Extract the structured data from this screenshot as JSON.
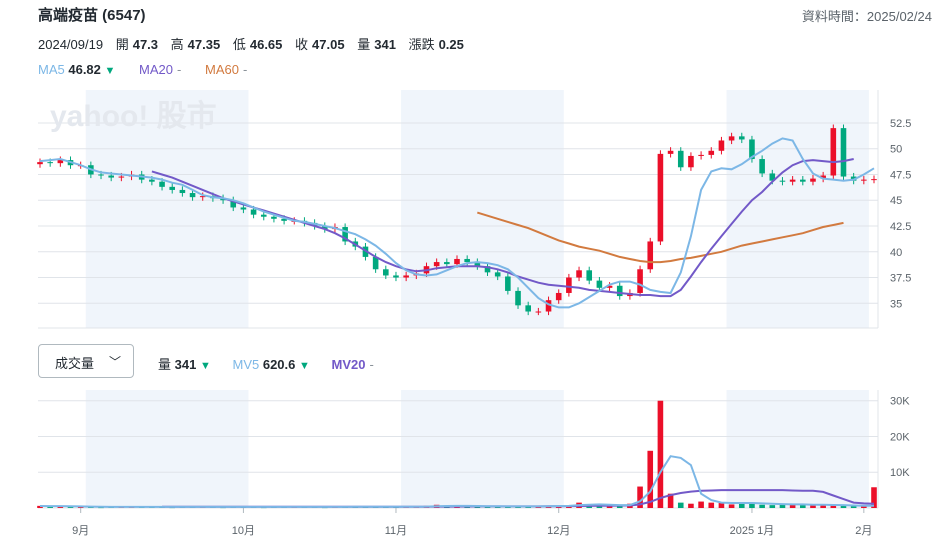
{
  "header": {
    "title": "高端疫苗 (6547)",
    "data_time": "資料時間：2025/02/24"
  },
  "ohlc": {
    "date": "2024/09/19",
    "open_label": "開",
    "open": "47.3",
    "high_label": "高",
    "high": "47.35",
    "low_label": "低",
    "low": "46.65",
    "close_label": "收",
    "close": "47.05",
    "volume_label": "量",
    "volume": "341",
    "change_label": "漲跌",
    "change": "0.25"
  },
  "ma_legend": {
    "ma5_label": "MA5",
    "ma5_value": "46.82",
    "ma20_label": "MA20",
    "ma60_label": "MA60",
    "dash": "-"
  },
  "vol_legend": {
    "dropdown_label": "成交量",
    "vol_label": "量",
    "vol_value": "341",
    "mv5_label": "MV5",
    "mv5_value": "620.6",
    "mv20_label": "MV20",
    "dash": "-"
  },
  "watermark": "yahoo! 股市",
  "colors": {
    "up": "#eb0f29",
    "down": "#00a87e",
    "ma5": "#7cb7e6",
    "ma20": "#7259c8",
    "ma60": "#d27a3f",
    "band": "#f0f5fb",
    "grid": "#e0e4e9"
  },
  "chart_data": [
    {
      "type": "candlestick",
      "title": "高端疫苗 (6547)",
      "y_ticks": [
        "52.5",
        "50",
        "47.5",
        "45",
        "42.5",
        "40",
        "37.5",
        "35"
      ],
      "ylim": [
        32.6,
        55.7
      ],
      "x_ticks": [
        "9月",
        "10月",
        "11月",
        "12月",
        "2025 1月",
        "2月"
      ],
      "series": [
        {
          "name": "MA5",
          "values": [
            48.8,
            48.9,
            49.0,
            48.7,
            48.4,
            48.0,
            47.7,
            47.6,
            47.5,
            47.4,
            47.3,
            47.2,
            47.0,
            46.7,
            46.5,
            46.0,
            45.5,
            45.3,
            45.2,
            45.0,
            44.7,
            44.3,
            43.9,
            43.6,
            43.3,
            43.0,
            42.9,
            42.7,
            42.5,
            42.3,
            42.0,
            41.7,
            41.2,
            40.6,
            39.8,
            38.9,
            38.2,
            37.8,
            37.7,
            37.8,
            38.2,
            38.6,
            38.9,
            39.0,
            38.9,
            38.7,
            38.3,
            37.5,
            36.5,
            35.5,
            34.9,
            34.6,
            34.6,
            35.0,
            35.6,
            36.2,
            36.8,
            37.1,
            37.1,
            36.8,
            36.3,
            36.1,
            36.0,
            38.0,
            41.5,
            46.0,
            47.8,
            48.1,
            48.0,
            48.5,
            49.2,
            49.8,
            50.5,
            51.0,
            50.8,
            49.0,
            47.6,
            47.1,
            47.0,
            46.9,
            47.0,
            47.5,
            48.1
          ]
        },
        {
          "name": "MA20",
          "values": [
            null,
            null,
            null,
            null,
            null,
            null,
            null,
            null,
            null,
            null,
            null,
            47.8,
            47.5,
            47.2,
            46.8,
            46.4,
            46.0,
            45.6,
            45.2,
            44.9,
            44.6,
            44.3,
            44.0,
            43.7,
            43.4,
            43.1,
            42.8,
            42.5,
            42.2,
            41.8,
            41.3,
            40.7,
            40.1,
            39.5,
            39.0,
            38.6,
            38.3,
            38.1,
            38.2,
            38.4,
            38.5,
            38.6,
            38.6,
            38.6,
            38.5,
            38.3,
            38.0,
            37.6,
            37.3,
            37.0,
            36.8,
            36.7,
            36.6,
            36.5,
            36.3,
            36.2,
            36.1,
            36.0,
            35.9,
            35.8,
            35.8,
            35.7,
            35.7,
            36.3,
            37.6,
            39.0,
            40.3,
            41.5,
            42.7,
            43.9,
            45.0,
            45.8,
            46.8,
            47.7,
            48.4,
            48.8,
            48.9,
            48.8,
            48.7,
            48.8,
            49.0,
            null,
            null
          ]
        },
        {
          "name": "MA60",
          "values": [
            null,
            null,
            null,
            null,
            null,
            null,
            null,
            null,
            null,
            null,
            null,
            null,
            null,
            null,
            null,
            null,
            null,
            null,
            null,
            null,
            null,
            null,
            null,
            null,
            null,
            null,
            null,
            null,
            null,
            null,
            null,
            null,
            null,
            null,
            null,
            null,
            null,
            null,
            null,
            null,
            null,
            null,
            null,
            43.8,
            43.5,
            43.2,
            42.9,
            42.6,
            42.3,
            41.9,
            41.5,
            41.1,
            40.8,
            40.5,
            40.3,
            40.1,
            39.8,
            39.5,
            39.3,
            39.1,
            39.0,
            39.0,
            39.1,
            39.3,
            39.4,
            39.6,
            39.8,
            40.0,
            40.3,
            40.6,
            40.8,
            41.0,
            41.2,
            41.4,
            41.6,
            41.8,
            42.1,
            42.4,
            42.6,
            42.8,
            null,
            null,
            null
          ]
        },
        {
          "name": "close",
          "values": [
            48.7,
            48.6,
            48.9,
            48.4,
            48.4,
            47.5,
            47.4,
            47.2,
            47.3,
            47.5,
            47.0,
            46.8,
            46.3,
            46.0,
            45.7,
            45.3,
            45.4,
            45.2,
            45.0,
            44.3,
            44.1,
            43.6,
            43.4,
            43.2,
            43.0,
            43.0,
            42.8,
            42.5,
            42.2,
            42.4,
            41.0,
            40.5,
            39.5,
            38.3,
            37.7,
            37.5,
            37.7,
            37.9,
            38.6,
            39.0,
            38.8,
            39.3,
            39.0,
            38.6,
            38.0,
            37.6,
            36.2,
            34.8,
            34.2,
            34.2,
            35.3,
            36.0,
            37.5,
            38.2,
            37.2,
            36.5,
            36.7,
            35.7,
            36.0,
            38.3,
            41.0,
            49.5,
            49.8,
            48.2,
            49.3,
            49.4,
            49.8,
            50.8,
            51.2,
            50.9,
            49.0,
            47.6,
            46.9,
            46.8,
            47.0,
            46.8,
            47.1,
            47.4,
            52.0,
            47.3,
            46.9,
            47.0,
            47.05
          ]
        }
      ]
    },
    {
      "type": "bar",
      "title": "成交量",
      "y_ticks": [
        "30K",
        "20K",
        "10K"
      ],
      "ylim": [
        0,
        33000
      ],
      "x_ticks": [
        "9月",
        "10月",
        "11月",
        "12月",
        "2025 1月",
        "2月"
      ],
      "series": [
        {
          "name": "量",
          "values": [
            600,
            500,
            400,
            500,
            300,
            300,
            250,
            300,
            400,
            300,
            300,
            300,
            300,
            250,
            300,
            400,
            300,
            300,
            250,
            300,
            300,
            300,
            250,
            300,
            300,
            300,
            300,
            300,
            250,
            300,
            300,
            400,
            400,
            350,
            300,
            300,
            400,
            300,
            600,
            900,
            600,
            500,
            400,
            450,
            500,
            400,
            500,
            500,
            400,
            400,
            700,
            600,
            800,
            1500,
            900,
            700,
            600,
            500,
            1200,
            6000,
            16000,
            30000,
            4000,
            1500,
            1200,
            1800,
            1500,
            1600,
            1000,
            1200,
            1500,
            900,
            800,
            1200,
            900,
            800,
            800,
            900,
            800,
            700,
            600,
            600,
            5800
          ]
        },
        {
          "name": "MV5",
          "values": [
            550,
            540,
            520,
            500,
            450,
            400,
            350,
            300,
            300,
            300,
            300,
            300,
            300,
            300,
            300,
            300,
            300,
            300,
            300,
            300,
            300,
            300,
            300,
            300,
            300,
            300,
            300,
            300,
            300,
            300,
            300,
            330,
            350,
            350,
            350,
            350,
            350,
            350,
            400,
            500,
            560,
            600,
            600,
            560,
            500,
            470,
            460,
            460,
            460,
            460,
            500,
            550,
            600,
            800,
            900,
            1000,
            900,
            800,
            800,
            1900,
            4600,
            10000,
            14500,
            14000,
            12000,
            4000,
            2200,
            1500,
            1400,
            1400,
            1400,
            1300,
            1200,
            1100,
            1000,
            1000,
            900,
            900,
            850,
            800,
            700,
            650,
            620.6
          ]
        },
        {
          "name": "MV20",
          "values": [
            null,
            null,
            null,
            null,
            null,
            null,
            null,
            null,
            null,
            null,
            null,
            null,
            350,
            340,
            330,
            330,
            330,
            330,
            330,
            330,
            330,
            330,
            330,
            330,
            330,
            330,
            330,
            330,
            330,
            330,
            330,
            330,
            330,
            330,
            330,
            330,
            330,
            330,
            350,
            380,
            400,
            420,
            430,
            440,
            450,
            450,
            450,
            450,
            450,
            460,
            480,
            500,
            520,
            560,
            600,
            620,
            640,
            660,
            700,
            1000,
            1700,
            2800,
            3600,
            4200,
            4600,
            4800,
            4900,
            5000,
            5000,
            5000,
            5000,
            5000,
            5000,
            5000,
            4900,
            4800,
            4800,
            4500,
            3500,
            2500,
            1500,
            1300,
            1200
          ]
        }
      ]
    }
  ]
}
